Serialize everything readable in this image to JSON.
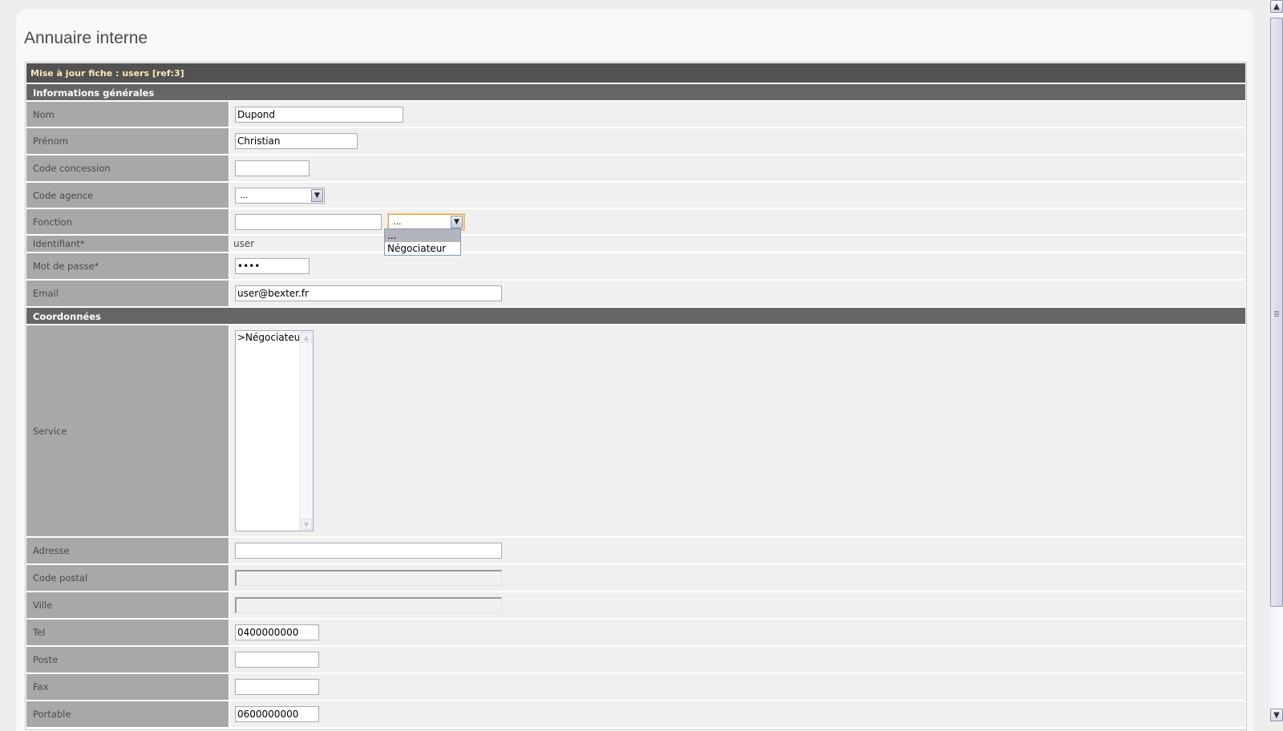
{
  "page": {
    "title": "Annuaire interne"
  },
  "form": {
    "header": "Mise à jour fiche : users [ref:3]",
    "sections": [
      {
        "title": "Informations générales"
      },
      {
        "title": "Coordonnées"
      }
    ],
    "fields": {
      "nom": {
        "label": "Nom",
        "value": "Dupond"
      },
      "prenom": {
        "label": "Prénom",
        "value": "Christian"
      },
      "code_concession": {
        "label": "Code concession",
        "value": ""
      },
      "code_agence": {
        "label": "Code agence",
        "selected": "..."
      },
      "fonction": {
        "label": "Fonction",
        "value": "",
        "selected": "...",
        "options": [
          "...",
          "Négociateur"
        ]
      },
      "identifiant": {
        "label": "Identifiant*",
        "value": "user"
      },
      "mot_de_passe": {
        "label": "Mot de passe*",
        "value": "user"
      },
      "email": {
        "label": "Email",
        "value": "user@bexter.fr"
      },
      "service": {
        "label": "Service",
        "options": [
          ">Négociateur"
        ]
      },
      "adresse": {
        "label": "Adresse",
        "value": ""
      },
      "code_postal": {
        "label": "Code postal",
        "value": ""
      },
      "ville": {
        "label": "Ville",
        "value": ""
      },
      "tel": {
        "label": "Tel",
        "value": "0400000000"
      },
      "poste": {
        "label": "Poste",
        "value": ""
      },
      "fax": {
        "label": "Fax",
        "value": ""
      },
      "portable": {
        "label": "Portable",
        "value": "0600000000"
      }
    }
  },
  "icons": {
    "dropdown_arrow": "▼",
    "scroll_up": "▲",
    "scroll_down": "▼"
  }
}
